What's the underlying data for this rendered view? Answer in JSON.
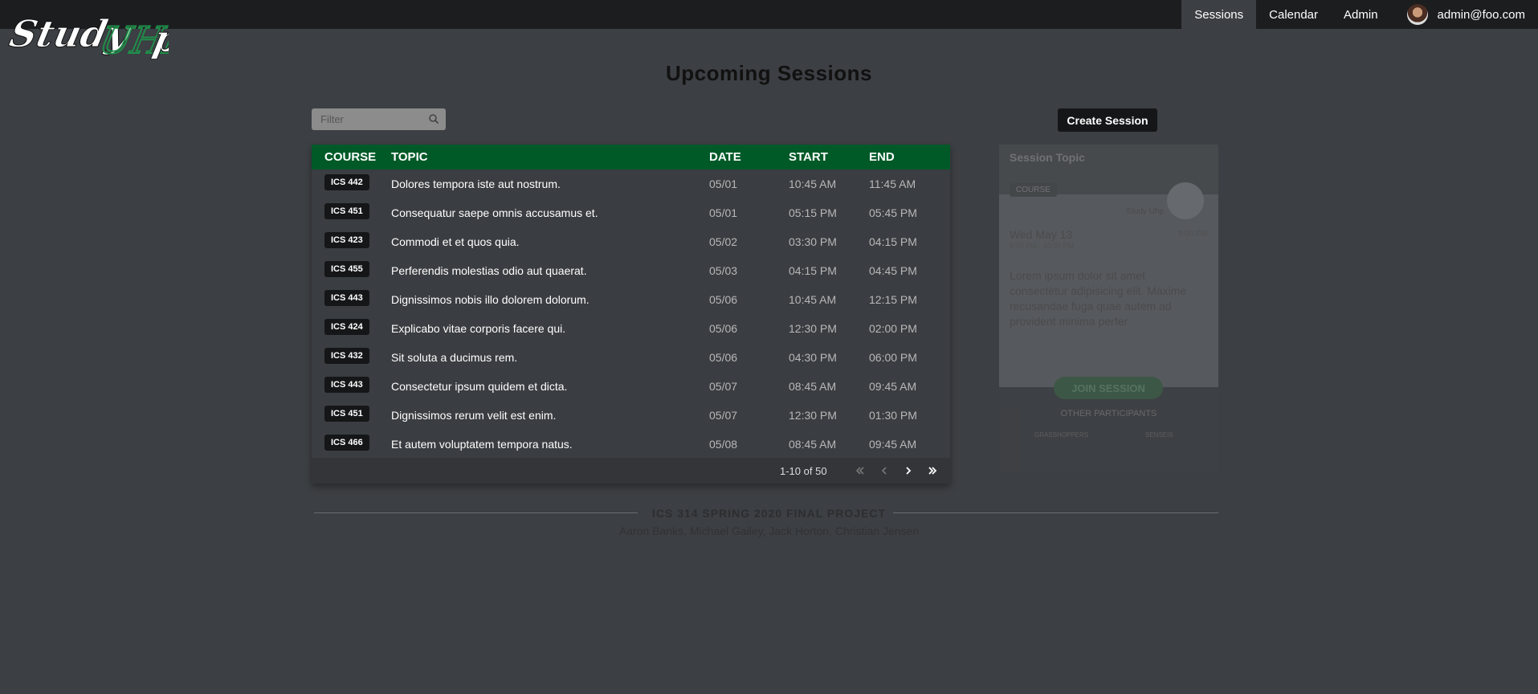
{
  "brand": {
    "logo_text_1": "Study",
    "logo_text_2": "UHH",
    "logo_text_3": "p",
    "accent": "#005a28"
  },
  "nav": {
    "items": [
      {
        "label": "Sessions",
        "active": true
      },
      {
        "label": "Calendar",
        "active": false
      },
      {
        "label": "Admin",
        "active": false
      }
    ],
    "user_email": "admin@foo.com"
  },
  "page": {
    "title": "Upcoming Sessions"
  },
  "filter": {
    "placeholder": "Filter",
    "value": ""
  },
  "create_button": "Create Session",
  "table": {
    "headers": {
      "course": "COURSE",
      "topic": "TOPIC",
      "date": "DATE",
      "start": "START",
      "end": "END"
    },
    "rows": [
      {
        "course": "ICS 442",
        "topic": "Dolores tempora iste aut nostrum.",
        "date": "05/01",
        "start": "10:45 AM",
        "end": "11:45 AM"
      },
      {
        "course": "ICS 451",
        "topic": "Consequatur saepe omnis accusamus et.",
        "date": "05/01",
        "start": "05:15 PM",
        "end": "05:45 PM"
      },
      {
        "course": "ICS 423",
        "topic": "Commodi et et quos quia.",
        "date": "05/02",
        "start": "03:30 PM",
        "end": "04:15 PM"
      },
      {
        "course": "ICS 455",
        "topic": "Perferendis molestias odio aut quaerat.",
        "date": "05/03",
        "start": "04:15 PM",
        "end": "04:45 PM"
      },
      {
        "course": "ICS 443",
        "topic": "Dignissimos nobis illo dolorem dolorum.",
        "date": "05/06",
        "start": "10:45 AM",
        "end": "12:15 PM"
      },
      {
        "course": "ICS 424",
        "topic": "Explicabo vitae corporis facere qui.",
        "date": "05/06",
        "start": "12:30 PM",
        "end": "02:00 PM"
      },
      {
        "course": "ICS 432",
        "topic": "Sit soluta a ducimus rem.",
        "date": "05/06",
        "start": "04:30 PM",
        "end": "06:00 PM"
      },
      {
        "course": "ICS 443",
        "topic": "Consectetur ipsum quidem et dicta.",
        "date": "05/07",
        "start": "08:45 AM",
        "end": "09:45 AM"
      },
      {
        "course": "ICS 451",
        "topic": "Dignissimos rerum velit est enim.",
        "date": "05/07",
        "start": "12:30 PM",
        "end": "01:30 PM"
      },
      {
        "course": "ICS 466",
        "topic": "Et autem voluptatem tempora natus.",
        "date": "05/08",
        "start": "08:45 AM",
        "end": "09:45 AM"
      }
    ],
    "pagination": "1-10 of 50"
  },
  "session_card": {
    "title": "Session Topic",
    "course": "COURSE",
    "university": "Study Uhp",
    "date": "Wed May 13",
    "time": "9:00 PM - 10:00 PM",
    "right_time": "9:00 PM",
    "description": "Lorem ipsum dolor sit amet consectetur adipisicing elit. Maxime recusandae fuga quae autem ad provident minima perfer",
    "join": "JOIN SESSION",
    "other_label": "OTHER PARTICIPANTS",
    "participants": [
      "GRASSHOPPERS",
      "SENSEIS"
    ]
  },
  "footer": {
    "title": "ICS 314 SPRING 2020 FINAL PROJECT",
    "authors": "Aaron Banks, Michael Gailey, Jack Horton, Christian Jensen"
  }
}
